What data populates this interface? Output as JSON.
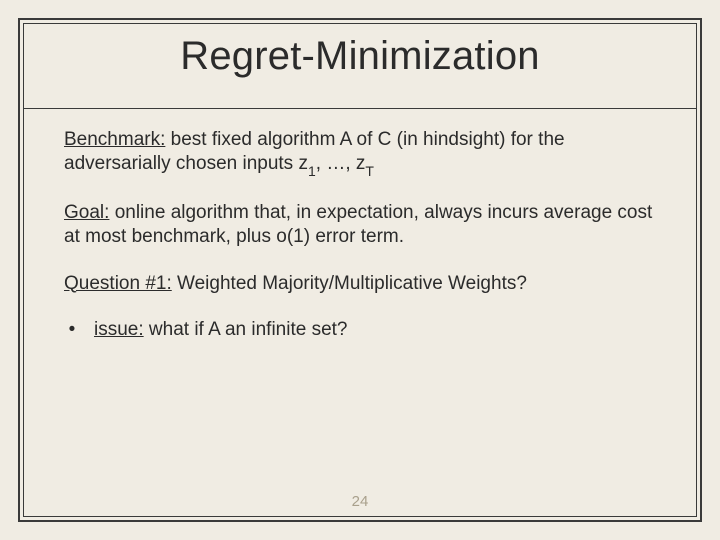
{
  "slide": {
    "title": "Regret-Minimization",
    "page_number": "24"
  },
  "body": {
    "benchmark": {
      "label": "Benchmark:",
      "text_before_z": " best fixed algorithm A of C (in hindsight) for the adversarially chosen inputs z",
      "sub1": "1",
      "mid": ", …, z",
      "subT": "T"
    },
    "goal": {
      "label": "Goal:",
      "text": " online algorithm that, in expectation, always incurs average cost at most benchmark, plus o(1) error term."
    },
    "question": {
      "label": "Question #1:",
      "text": " Weighted Majority/Multiplicative Weights?"
    },
    "bullet": {
      "dot": "•",
      "issue_label": "issue:",
      "issue_text": " what if A an infinite set?"
    }
  }
}
